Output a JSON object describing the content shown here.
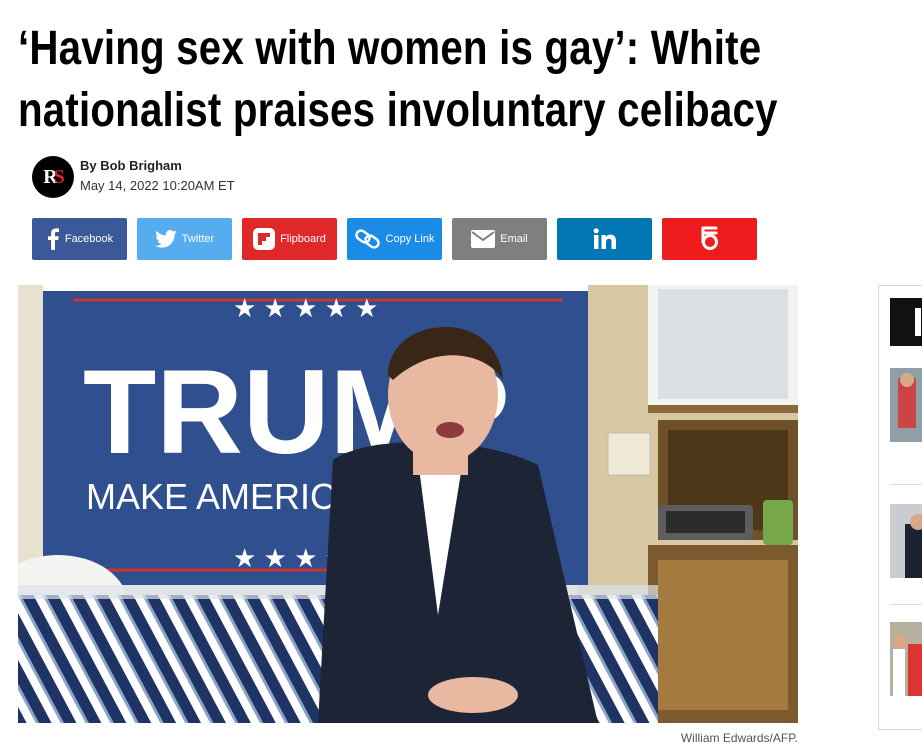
{
  "article": {
    "headline_line1": "‘Having sex with women is gay’: White",
    "headline_line2": "nationalist praises involuntary celibacy",
    "publisher_logo_text": "RS",
    "author": "By Bob Brigham",
    "date": "May 14, 2022 10:20AM ET"
  },
  "share": [
    {
      "label": "Facebook",
      "icon": "facebook-icon",
      "color": "#3b5998"
    },
    {
      "label": "Twitter",
      "icon": "twitter-icon",
      "color": "#55acee"
    },
    {
      "label": "Flipboard",
      "icon": "flipboard-icon",
      "color": "#e12828"
    },
    {
      "label": "Copy Link",
      "icon": "link-icon",
      "color": "#1a8ce5"
    },
    {
      "label": "Email",
      "icon": "email-icon",
      "color": "#7f7f7f"
    },
    {
      "label": "",
      "icon": "linkedin-icon",
      "color": "#0077b5"
    },
    {
      "label": "",
      "icon": "bluesky-icon",
      "color": "#ee1c1c"
    }
  ],
  "photo": {
    "flag_text": "TRUMP",
    "flag_slogan": "MAKE AMERICA G",
    "credit": "William Edwards/AFP."
  }
}
